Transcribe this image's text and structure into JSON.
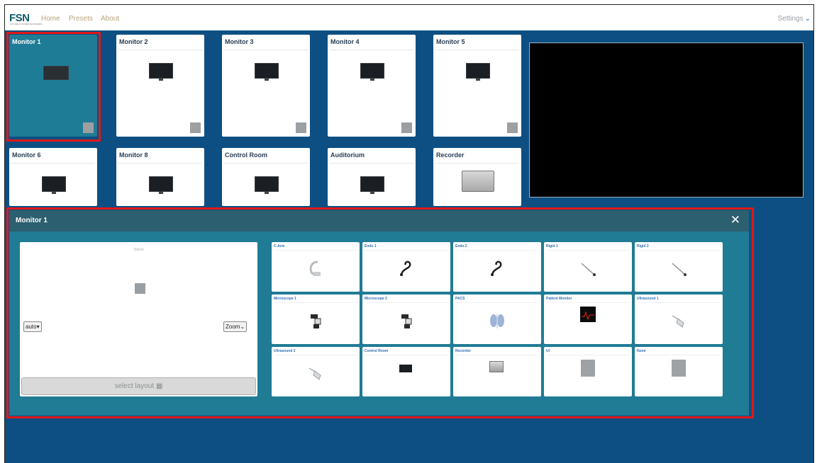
{
  "app": {
    "logo": "FSN",
    "logo_sub": "FUTURE SYSTEMS NETWORKS",
    "nav": [
      "Home",
      "Presets",
      "About"
    ],
    "settings_label": "Settings"
  },
  "monitors": [
    {
      "name": "Monitor 1",
      "selected": true
    },
    {
      "name": "Monitor 2"
    },
    {
      "name": "Monitor 3"
    },
    {
      "name": "Monitor 4"
    },
    {
      "name": "Monitor 5"
    },
    {
      "name": "Monitor 6"
    },
    {
      "name": "Monitor 8"
    },
    {
      "name": "Control Room"
    },
    {
      "name": "Auditorium"
    },
    {
      "name": "Recorder"
    }
  ],
  "panel": {
    "title": "Monitor 1",
    "close_glyph": "✕",
    "layout": {
      "none_label": "None",
      "auto_label": "auto▾",
      "zoom_label": "Zoom⌄",
      "select_layout_label": "select layout ▦"
    },
    "sources": [
      {
        "name": "C-Arm",
        "icon": "c-arm-icon"
      },
      {
        "name": "Endo 1",
        "icon": "endoscope-icon"
      },
      {
        "name": "Endo 2",
        "icon": "endoscope-icon"
      },
      {
        "name": "Rigid 1",
        "icon": "rigid-scope-icon"
      },
      {
        "name": "Rigid 2",
        "icon": "rigid-scope-icon"
      },
      {
        "name": "Microscope 1",
        "icon": "microscope-icon"
      },
      {
        "name": "Microscope 2",
        "icon": "microscope-icon"
      },
      {
        "name": "PACS",
        "icon": "xray-icon"
      },
      {
        "name": "Patient Monitor",
        "icon": "patient-monitor-icon"
      },
      {
        "name": "Ultrasound 1",
        "icon": "ultrasound-icon"
      },
      {
        "name": "Ultrasound 2",
        "icon": "ultrasound-icon"
      },
      {
        "name": "Control Room",
        "icon": "monitor-icon"
      },
      {
        "name": "Recorder",
        "icon": "recorder-icon"
      },
      {
        "name": "UI",
        "icon": "placeholder-icon"
      },
      {
        "name": "None",
        "icon": "placeholder-icon"
      }
    ]
  },
  "colors": {
    "background": "#0d4f82",
    "panel": "#207b95",
    "panel_header": "#2c5f6f",
    "selection_outline": "#e11818",
    "nav_link": "#b9a27b",
    "source_label": "#2f6fb2"
  }
}
